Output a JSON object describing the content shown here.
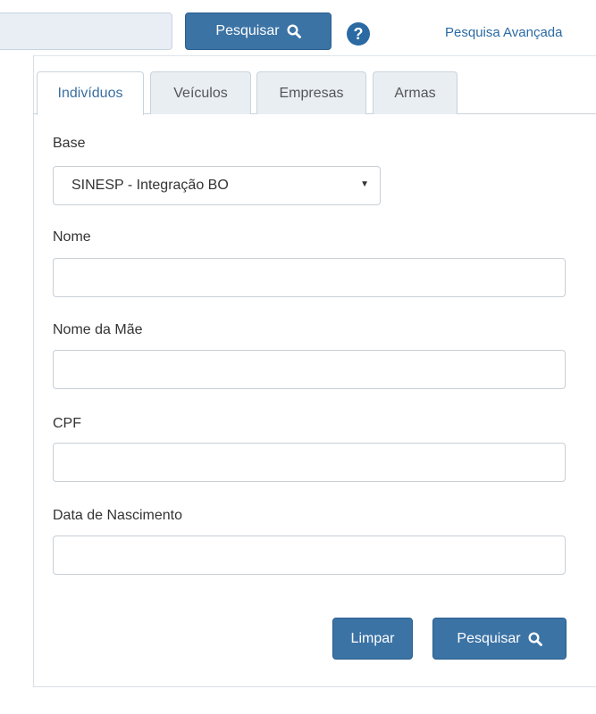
{
  "topbar": {
    "search_value": "",
    "search_button_label": "Pesquisar",
    "help_icon": "question-circle-icon",
    "advanced_link": "Pesquisa Avançada"
  },
  "tabs": [
    {
      "label": "Indivíduos",
      "active": true
    },
    {
      "label": "Veículos",
      "active": false
    },
    {
      "label": "Empresas",
      "active": false
    },
    {
      "label": "Armas",
      "active": false
    }
  ],
  "form": {
    "base": {
      "label": "Base",
      "selected": "SINESP - Integração BO"
    },
    "nome": {
      "label": "Nome",
      "value": ""
    },
    "nome_mae": {
      "label": "Nome da Mãe",
      "value": ""
    },
    "cpf": {
      "label": "CPF",
      "value": ""
    },
    "data_nascimento": {
      "label": "Data de Nascimento",
      "value": ""
    }
  },
  "actions": {
    "clear_label": "Limpar",
    "submit_label": "Pesquisar"
  },
  "colors": {
    "primary": "#3b73a5",
    "link": "#2b6aa3",
    "active_tab_text": "#3a6fa0"
  }
}
